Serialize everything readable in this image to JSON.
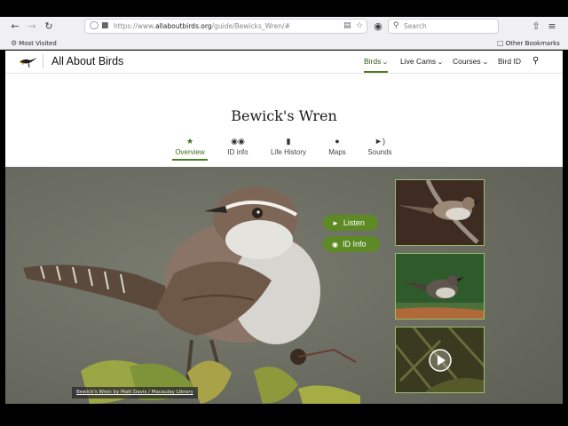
{
  "browser": {
    "url_prefix": "https://www.",
    "url_domain": "allaboutbirds.org",
    "url_path": "/guide/Bewicks_Wren/#",
    "search_placeholder": "Search",
    "bookmarks": {
      "most_visited": "Most Visited",
      "other": "Other Bookmarks"
    }
  },
  "site": {
    "logo_text": "All About Birds",
    "menu": [
      "Birds",
      "Live Cams",
      "Courses",
      "Bird ID"
    ]
  },
  "species": {
    "title": "Bewick's Wren"
  },
  "tabs": [
    "Overview",
    "ID info",
    "Life History",
    "Maps",
    "Sounds"
  ],
  "hero": {
    "listen_label": "Listen",
    "idinfo_label": "ID Info",
    "credit": "Bewick's Wren by Matt Davis / Macaulay Library"
  },
  "icons": [
    "back-icon",
    "forward-icon",
    "reload-icon",
    "shield-icon",
    "lock-icon",
    "reader-icon",
    "bookmark-star-icon",
    "pocket-icon",
    "search-icon",
    "extensions-icon",
    "menu-icon",
    "gear-icon",
    "folder-icon",
    "star-icon",
    "binoculars-icon",
    "book-icon",
    "globe-icon",
    "speaker-icon",
    "play-icon"
  ],
  "colors": {
    "accent": "#4d7c23",
    "pill": "#5d8a24",
    "hero_bg": "#74756a"
  }
}
